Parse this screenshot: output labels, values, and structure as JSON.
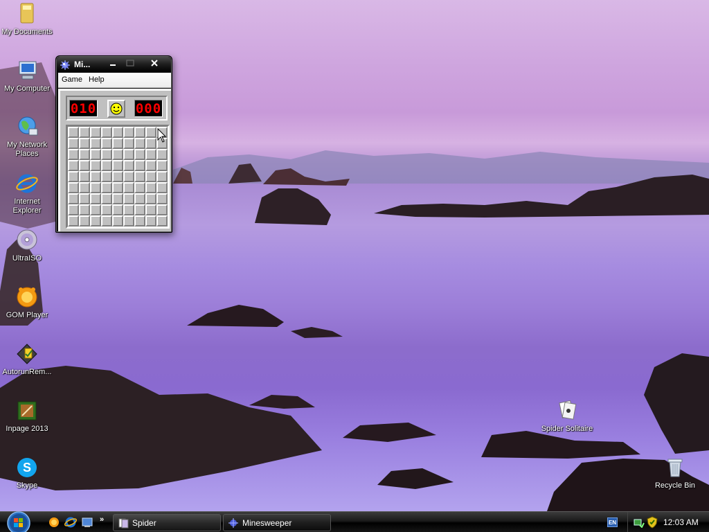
{
  "desktop": {
    "icons": [
      {
        "label": "My Documents"
      },
      {
        "label": "My Computer"
      },
      {
        "label": "My Network Places"
      },
      {
        "label": "Internet Explorer"
      },
      {
        "label": "UltraISO"
      },
      {
        "label": "GOM Player"
      },
      {
        "label": "AutorunRem..."
      },
      {
        "label": "Inpage 2013"
      },
      {
        "label": "Skype"
      },
      {
        "label": "Spider Solitaire"
      },
      {
        "label": "Recycle Bin"
      }
    ]
  },
  "minesweeper": {
    "title": "Mi...",
    "menu": {
      "game": "Game",
      "help": "Help"
    },
    "mine_counter": "010",
    "timer": "000",
    "grid": {
      "rows": 9,
      "cols": 9
    }
  },
  "taskbar": {
    "tasks": [
      {
        "label": "Spider"
      },
      {
        "label": "Minesweeper"
      }
    ],
    "quick_launch_more": "»",
    "language": "EN",
    "clock": "12:03 AM"
  },
  "colors": {
    "lcd_red": "#ff0000",
    "window_frame": "#0b0b0b",
    "classic_gray": "#c0c0c0"
  }
}
